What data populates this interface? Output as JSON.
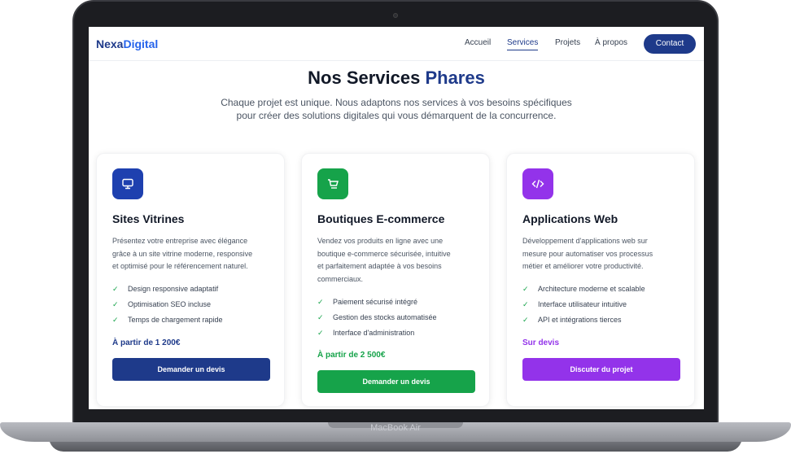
{
  "device": {
    "label": "MacBook Air"
  },
  "nav": {
    "logo_part1": "Nexa",
    "logo_part2": "Digital",
    "items": [
      "Accueil",
      "Services",
      "Projets",
      "À propos"
    ],
    "contact_label": "Contact"
  },
  "hero": {
    "title_part1": "Nos Services ",
    "title_part2": "Phares",
    "subtitle_line1": "Chaque projet est unique. Nous adaptons nos services à vos besoins spécifiques",
    "subtitle_line2": "pour créer des solutions digitales qui vous démarquent de la concurrence."
  },
  "cards": [
    {
      "title": "Sites Vitrines",
      "icon": "monitor-icon",
      "color": "#1e3a8a",
      "desc_lines": [
        "Présentez votre entreprise avec élégance",
        "grâce à un site vitrine moderne, responsive",
        "et optimisé pour le référencement naturel."
      ],
      "features": [
        "Design responsive adaptatif",
        "Optimisation SEO incluse",
        "Temps de chargement rapide"
      ],
      "price": "À partir de 1 200€",
      "button": "Demander un devis"
    },
    {
      "title": "Boutiques E-commerce",
      "icon": "cart-icon",
      "color": "#16a34a",
      "desc_lines": [
        "Vendez vos produits en ligne avec une",
        "boutique e-commerce sécurisée, intuitive",
        "et parfaitement adaptée à vos besoins",
        "commerciaux."
      ],
      "features": [
        "Paiement sécurisé intégré",
        "Gestion des stocks automatisée",
        "Interface d'administration"
      ],
      "price": "À partir de 2 500€",
      "button": "Demander un devis"
    },
    {
      "title": "Applications Web",
      "icon": "code-icon",
      "color": "#9333ea",
      "desc_lines": [
        "Développement d'applications web sur",
        "mesure pour automatiser vos processus",
        "métier et améliorer votre productivité."
      ],
      "features": [
        "Architecture moderne et scalable",
        "Interface utilisateur intuitive",
        "API et intégrations tierces"
      ],
      "price": "Sur devis",
      "button": "Discuter du projet"
    }
  ]
}
